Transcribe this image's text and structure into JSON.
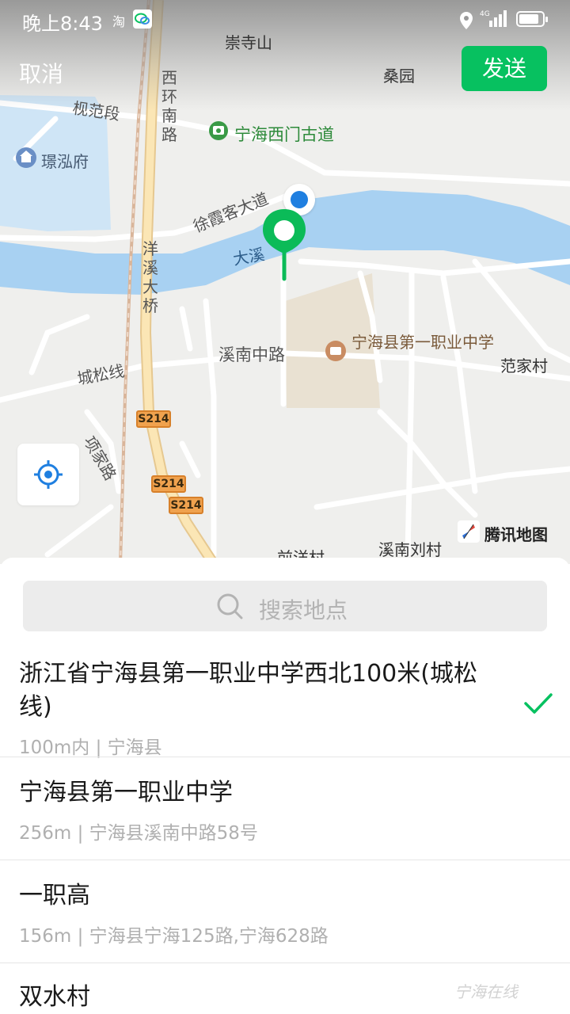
{
  "status_bar": {
    "time": "晚上8:43",
    "taobao": "淘",
    "network": "4G",
    "icons": [
      "location-icon",
      "signal-icon",
      "battery-icon",
      "wechat-icon"
    ]
  },
  "header": {
    "cancel_label": "取消",
    "send_label": "发送",
    "accent_color": "#07c160"
  },
  "map": {
    "place_labels": {
      "chongsishan": "崇寺山",
      "sangyuan": "桑园",
      "guifanduan": "枧范段",
      "jinghongfu": "璟泓府",
      "xihuan_nanlu": "西环南路",
      "xuxiake_dadao": "徐霞客大道",
      "daxi": "大溪",
      "yangxi_daqiao": "洋溪大桥",
      "xinan_zhonglu": "溪南中路",
      "chengsongxian": "城松线",
      "xiangjialu": "项家路",
      "fanjiacun": "范家村",
      "xinan_liucun": "溪南刘村",
      "qianyangcun": "前洋村"
    },
    "poi_gate": "宁海西门古道",
    "poi_school": "宁海县第一职业中学",
    "road_shield": "S214",
    "brand": "腾讯地图",
    "river_color": "#a8d1f2",
    "road_highlight_color": "#fbe6b5"
  },
  "search": {
    "placeholder": "搜索地点"
  },
  "results": [
    {
      "title": "浙江省宁海县第一职业中学西北100米(城松线)",
      "subtitle": "100m内 | 宁海县",
      "selected": true
    },
    {
      "title": "宁海县第一职业中学",
      "subtitle": "256m | 宁海县溪南中路58号",
      "selected": false
    },
    {
      "title": "一职高",
      "subtitle": "156m | 宁海县宁海125路,宁海628路",
      "selected": false
    },
    {
      "title": "双水村",
      "subtitle": "",
      "selected": false
    }
  ],
  "watermark": "宁海在线"
}
